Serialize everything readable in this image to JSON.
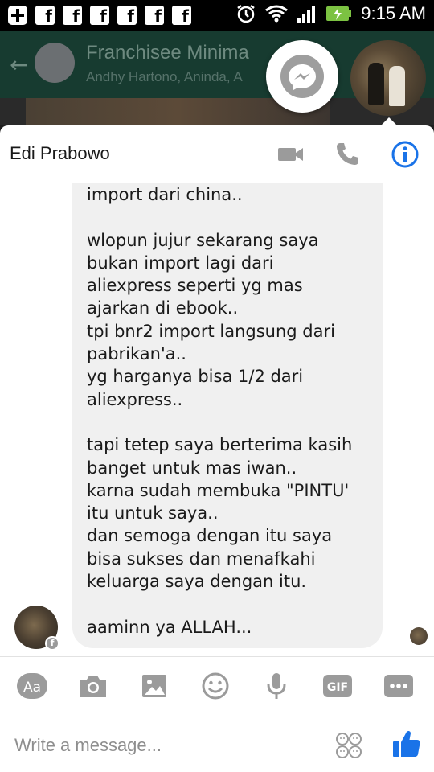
{
  "status_bar": {
    "time": "9:15 AM",
    "icons": [
      "add-icon",
      "facebook-icon",
      "facebook-icon",
      "facebook-icon",
      "facebook-icon",
      "facebook-icon",
      "facebook-icon",
      "alarm-icon",
      "wifi-icon",
      "signal-icon",
      "battery-charging-icon"
    ]
  },
  "background_group": {
    "title": "Franchisee Minima",
    "members": "Andhy Hartono, Aninda, A"
  },
  "conversation": {
    "contact_name": "Edi Prabowo",
    "actions": [
      "video-call-icon",
      "phone-icon",
      "info-icon"
    ],
    "message_text": "import dari china..\n\nwlopun jujur sekarang saya\nbukan import lagi dari\naliexpress seperti yg mas\najarkan di ebook..\ntpi bnr2 import langsung dari\npabrikan'a..\nyg harganya bisa 1/2 dari\naliexpress..\n\ntapi tetep saya berterima kasih\nbanget untuk mas iwan..\nkarna sudah membuka \"PINTU'\nitu untuk saya..\ndan semoga dengan itu saya\nbisa sukses dan menafkahi\nkeluarga saya dengan itu.\n\naaminn ya ALLAH..."
  },
  "composer": {
    "placeholder": "Write a message...",
    "tools": [
      "text-style-icon",
      "camera-icon",
      "gallery-icon",
      "emoji-icon",
      "microphone-icon",
      "gif-icon",
      "more-icon"
    ],
    "aa_label": "Aa",
    "gif_label": "GIF"
  },
  "colors": {
    "accent": "#1a73e8",
    "icon_gray": "#9b9b9b",
    "bubble_bg": "#f0f0f0"
  }
}
